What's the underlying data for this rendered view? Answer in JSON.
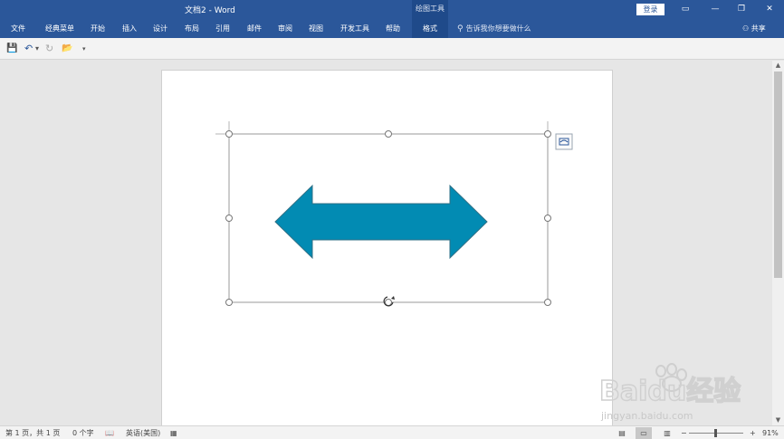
{
  "window": {
    "title": "文档2  -  Word",
    "context_group": "绘图工具",
    "login_label": "登录",
    "controls": {
      "options": "▭",
      "minimize": "—",
      "restore": "❐",
      "close": "✕"
    }
  },
  "ribbon": {
    "tabs": [
      {
        "label": "文件"
      },
      {
        "label": "经典菜单"
      },
      {
        "label": "开始"
      },
      {
        "label": "插入"
      },
      {
        "label": "设计"
      },
      {
        "label": "布局"
      },
      {
        "label": "引用"
      },
      {
        "label": "邮件"
      },
      {
        "label": "审阅"
      },
      {
        "label": "视图"
      },
      {
        "label": "开发工具"
      },
      {
        "label": "帮助"
      },
      {
        "label": "格式"
      }
    ],
    "active_tab": "格式",
    "tell_me_placeholder": "告诉我你想要做什么",
    "share_label": "共享"
  },
  "qat": {
    "save_icon": "💾",
    "undo_icon": "↶",
    "undo_dropdown": "▾",
    "redo_icon": "↻",
    "open_icon": "📂",
    "customize_icon": "▾"
  },
  "document": {
    "shape": {
      "type": "left-right-arrow",
      "fill": "#028bb3",
      "stroke": "#2f6f85"
    },
    "layout_options_icon": "layout-options-icon"
  },
  "statusbar": {
    "page_info": "第 1 页，共 1 页",
    "word_count": "0 个字",
    "proofing_icon": "📖",
    "language": "英语(美国)",
    "macro_icon": "▦",
    "view_read": "▤",
    "view_print": "▭",
    "view_web": "▥",
    "zoom_minus": "−",
    "zoom_plus": "+",
    "zoom_level": "91%"
  },
  "watermark": {
    "brand": "Baidu经验",
    "url": "jingyan.baidu.com"
  },
  "colors": {
    "accent": "#2b579a",
    "arrow_fill": "#028bb3"
  }
}
